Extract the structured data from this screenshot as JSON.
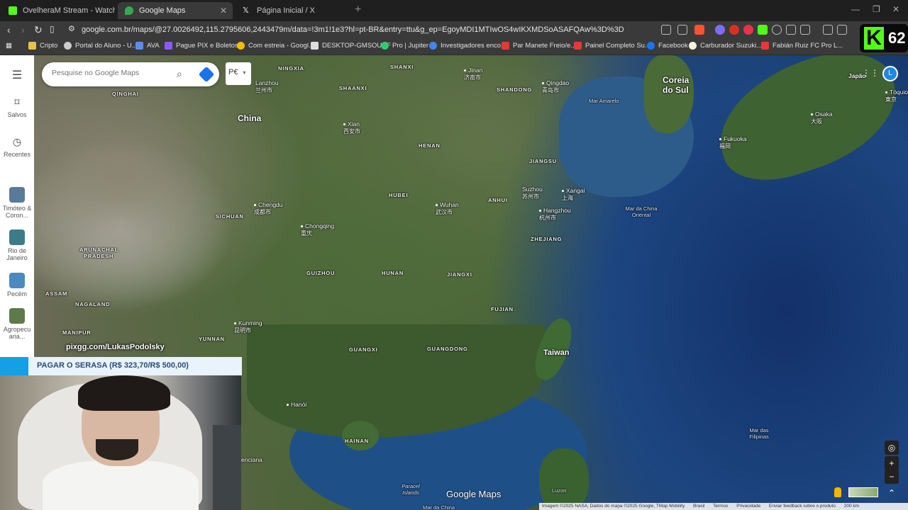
{
  "browser": {
    "tabs": [
      {
        "title": "OvelheraM Stream - Watch Live on K",
        "active": false,
        "favicon_color": "#53fc18"
      },
      {
        "title": "Google Maps",
        "active": true,
        "favicon_color": "#34a853"
      },
      {
        "title": "Página Inicial / X",
        "active": false,
        "favicon_color": "#ffffff"
      }
    ],
    "new_tab": "+",
    "url": "google.com.br/maps/@27.0026492,115.2795606,2443479m/data=!3m1!1e3?hl=pt-BR&entry=ttu&g_ep=EgoyMDI1MTIwOS4wIKXMDSoASAFQAw%3D%3D",
    "bookmarks": [
      {
        "label": "Cripto",
        "color": "#e8c34a"
      },
      {
        "label": "Portal do Aluno - U...",
        "color": "#cccccc"
      },
      {
        "label": "AVA",
        "color": "#5b8def"
      },
      {
        "label": "Pague PIX e Boletos...",
        "color": "#8a5cf5"
      },
      {
        "label": "Com estreia - Googl...",
        "color": "#fbbc04"
      },
      {
        "label": "DESKTOP-GMSOUHF",
        "color": "#dddddd"
      },
      {
        "label": "Pro | Jupiter",
        "color": "#2ecc71"
      },
      {
        "label": "Investigadores enco...",
        "color": "#4285f4"
      },
      {
        "label": "Par Manete Freio/e...",
        "color": "#e53935"
      },
      {
        "label": "Painel Completo Su...",
        "color": "#e53935"
      },
      {
        "label": "Facebook",
        "color": "#1877f2"
      },
      {
        "label": "Carburador Suzuki...",
        "color": "#f5f5dc"
      },
      {
        "label": "Fabián Ruiz FC Pro L...",
        "color": "#e53935"
      }
    ],
    "kick_badge": {
      "letter": "K",
      "count": "62"
    }
  },
  "sidebar": {
    "items": [
      {
        "label": "Salvos",
        "icon": "bookmark-icon"
      },
      {
        "label": "Recentes",
        "icon": "history-icon"
      }
    ],
    "recents": [
      {
        "label": "Timóteo & Coron...",
        "color": "#5a7a9a"
      },
      {
        "label": "Rio de Janeiro",
        "color": "#3d7a8a"
      },
      {
        "label": "Pecém",
        "color": "#4a8abf"
      },
      {
        "label": "Agropecu aria...",
        "color": "#5f7a4a"
      }
    ]
  },
  "maps": {
    "search_placeholder": "Pesquise no Google Maps",
    "chip_label": "P€",
    "avatar_letter": "L",
    "logo": "Google Maps",
    "labels": {
      "china": "China",
      "coreia": "Coreia",
      "do_sul": "do Sul",
      "japao": "Japão",
      "taiwan": "Taiwan",
      "lanzhou": "Lanzhou",
      "lanzhou_cjk": "兰州市",
      "jinan": "Jinan",
      "jinan_cjk": "济南市",
      "qingdao": "Qingdao",
      "qingdao_cjk": "青岛市",
      "xian": "Xian",
      "xian_cjk": "西安市",
      "chengdu": "Chengdu",
      "chengdu_cjk": "成都市",
      "chongqing": "Chongqing",
      "chongqing_cjk": "重庆",
      "wuhan": "Wuhan",
      "wuhan_cjk": "武汉市",
      "suzhou": "Suzhou",
      "suzhou_cjk": "苏州市",
      "xangai": "Xangai",
      "xangai_cjk": "上海",
      "hangzhou": "Hangzhou",
      "hangzhou_cjk": "杭州市",
      "kunming": "Kunming",
      "kunming_cjk": "昆明市",
      "osaka": "Osaka",
      "osaka_cjk": "大阪",
      "fukuoka": "Fukuoka",
      "fukuoka_cjk": "福岡",
      "toquio": "Tóquio",
      "toquio_cjk": "東京",
      "hanoi": "Hanói",
      "enciana": "enciana",
      "mar_amarelo": "Mar Amarelo",
      "mar_china_oriental": "Mar da China Oriental",
      "mar_filipinas": "Mar das Filipinas",
      "mar_da_china": "Mar da China",
      "paracel": "Paracel Islands",
      "luzon": "Luzon",
      "qinghai": "QINGHAI",
      "shanxi": "SHANXI",
      "shaanxi": "SHAANXI",
      "shandong": "SHANDONG",
      "henan": "HENAN",
      "jiangsu": "JIANGSU",
      "hubei": "HUBEI",
      "anhui": "ANHUI",
      "sichuan": "SICHUAN",
      "zhejiang": "ZHEJIANG",
      "arunachal": "ARUNACHAL",
      "pradesh": "PRADESH",
      "guizhou": "GUIZHOU",
      "hunan": "HUNAN",
      "jiangxi": "JIANGXI",
      "fujian": "FUJIAN",
      "assam": "ASSAM",
      "nagaland": "NAGALAND",
      "manipur": "MANIPUR",
      "yunnan": "YUNNAN",
      "guangxi": "GUANGXI",
      "guangdong": "GUANGDONG",
      "hainan": "HAINAN",
      "ningxia": "NINGXIA"
    },
    "footer": {
      "imagery": "Imagem ©2025 NASA, Dados do mapa ©2025 Google, TMap Mobility",
      "country": "Brasil",
      "terms": "Termos",
      "privacy": "Privacidade",
      "feedback": "Enviar feedback sobre o produto",
      "scale": "200 km"
    }
  },
  "stream_overlay": {
    "link": "pixgg.com/LukasPodolsky",
    "goal": "PAGAR O SERASA (R$ 323,70/R$ 500,00)",
    "goal_progress": 0.647
  }
}
